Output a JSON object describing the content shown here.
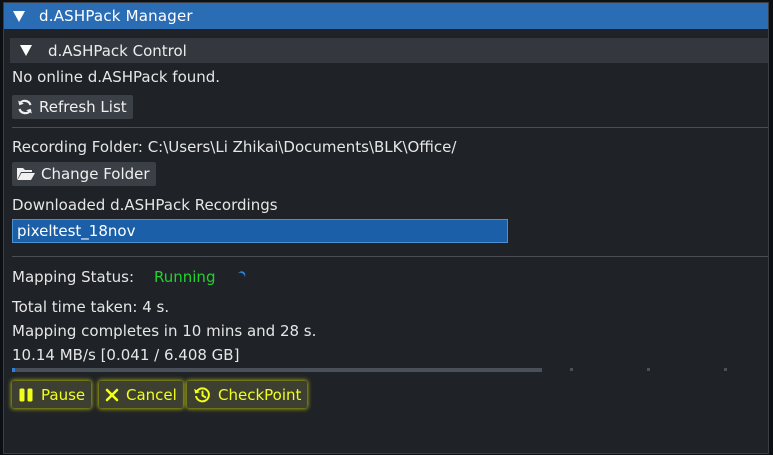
{
  "window": {
    "title": "d.ASHPack Manager"
  },
  "control_section": {
    "title": "d.ASHPack Control",
    "status_text": "No online d.ASHPack found.",
    "refresh_label": "Refresh List"
  },
  "recording": {
    "folder_text": "Recording Folder: C:\\Users\\Li Zhikai\\Documents\\BLK\\Office/",
    "change_folder_label": "Change Folder",
    "downloaded_heading": "Downloaded d.ASHPack Recordings",
    "selected_recording": "pixeltest_18nov"
  },
  "mapping": {
    "status_label": "Mapping Status:",
    "status_value": "Running",
    "total_time_text": "Total time taken:  4 s.",
    "completes_text": "Mapping completes in   10 mins and   28 s.",
    "transfer_text": "10.14 MB/s [0.041 / 6.408 GB]",
    "progress_fraction": 0.0064
  },
  "actions": {
    "pause_label": "Pause",
    "cancel_label": "Cancel",
    "checkpoint_label": "CheckPoint"
  },
  "colors": {
    "accent": "#2b6db5",
    "running": "#22d22c",
    "highlight_text": "#f2ff1a"
  },
  "icons": {
    "collapse": "triangle-down-icon",
    "refresh": "refresh-icon",
    "folder": "folder-open-icon",
    "pause": "pause-icon",
    "cancel": "close-icon",
    "checkpoint": "history-icon"
  }
}
